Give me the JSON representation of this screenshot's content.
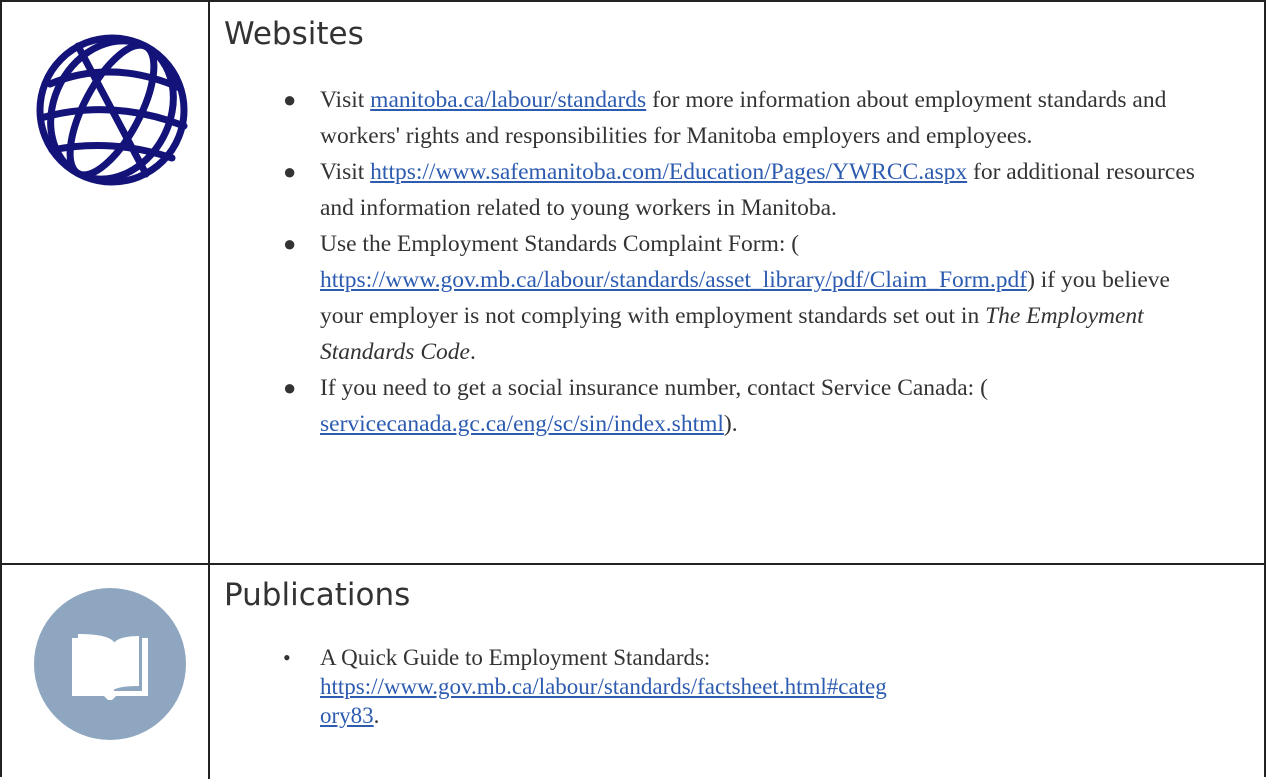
{
  "websites": {
    "heading": "Websites",
    "icon": "globe-icon",
    "items": [
      {
        "prefix": "Visit ",
        "link": "manitoba.ca/labour/standards",
        "suffix": " for more information about employment standards and workers' rights and responsibilities for Manitoba employers and employees."
      },
      {
        "prefix": "Visit ",
        "link": "https://www.safemanitoba.com/Education/Pages/YWRCC.aspx",
        "suffix": " for additional resources and information related to young workers in Manitoba."
      },
      {
        "prefix": "Use the Employment Standards Complaint Form: (",
        "link": "https://www.gov.mb.ca/labour/standards/asset_library/pdf/Claim_Form.pdf",
        "suffix": ") if you believe your employer is not complying with employment standards set out in ",
        "italic": "The Employment Standards Code",
        "end": "."
      },
      {
        "prefix": "If you need to get a social insurance number, contact Service Canada: (",
        "link": "servicecanada.gc.ca/eng/sc/sin/index.shtml",
        "suffix": ")."
      }
    ]
  },
  "publications": {
    "heading": "Publications",
    "icon": "book-icon",
    "items": [
      {
        "prefix": "A Quick Guide to Employment Standards: ",
        "link_part1": "https://www.gov.mb.ca/labour/standards/factsheet.html#categ",
        "link_part2": "ory83",
        "suffix": "."
      }
    ]
  },
  "colors": {
    "globe": "#13137a",
    "book_circle": "#8ea6bf",
    "link": "#2c5bb0",
    "border": "#222222"
  }
}
